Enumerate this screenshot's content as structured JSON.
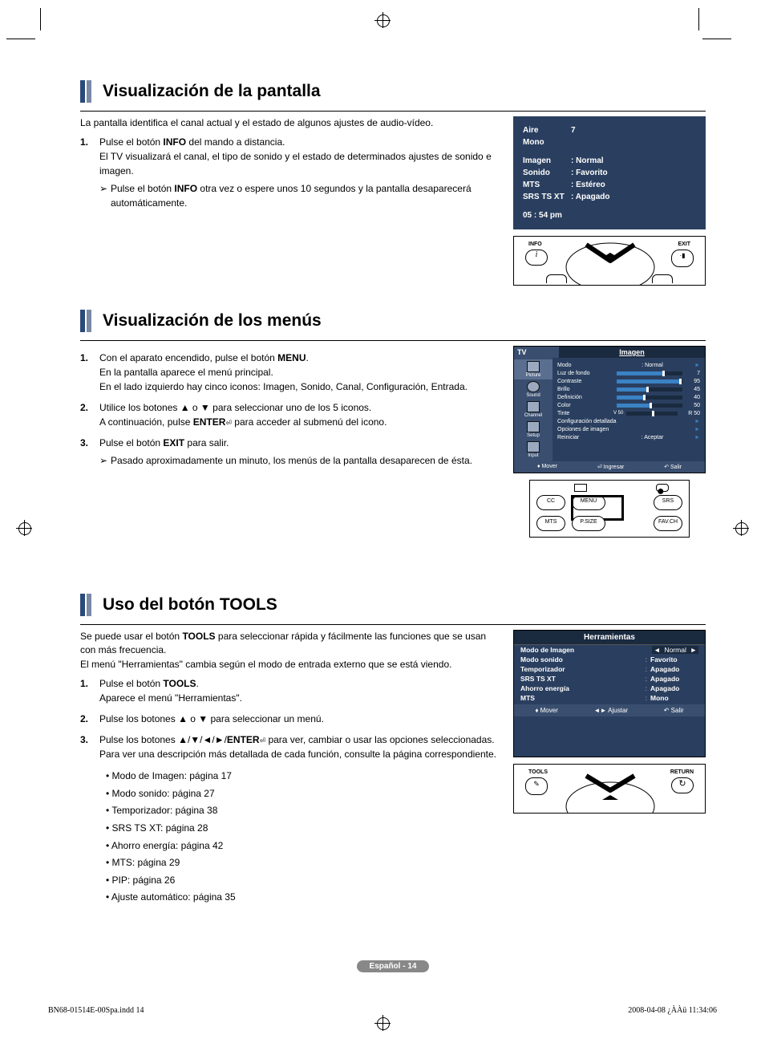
{
  "sections": {
    "s1": {
      "title": "Visualización de la pantalla",
      "intro": "La pantalla identifica el canal actual y el estado de algunos ajustes de audio-vídeo.",
      "step1a": "Pulse el botón ",
      "step1b": "INFO",
      "step1c": " del mando a distancia.",
      "step1d": "El TV visualizará el canal, el tipo de sonido y el estado de determinados ajustes de sonido e imagen.",
      "note1a": "Pulse el botón ",
      "note1b": "INFO",
      "note1c": " otra vez o espere unos 10 segundos y la pantalla desaparecerá automáticamente."
    },
    "s2": {
      "title": "Visualización de los menús",
      "step1a": "Con el aparato encendido, pulse el botón ",
      "step1b": "MENU",
      "step1c": ".",
      "step1d": "En la pantalla aparece el menú principal.",
      "step1e": "En el lado izquierdo hay cinco iconos: Imagen, Sonido, Canal, Configuración, Entrada.",
      "step2a": "Utilice los botones ▲ o ▼ para seleccionar uno de los 5 iconos.",
      "step2b": "A continuación, pulse ",
      "step2c": "ENTER",
      "step2d": " para acceder al submenú del icono.",
      "step3a": "Pulse el botón ",
      "step3b": "EXIT",
      "step3c": " para salir.",
      "note1": "Pasado aproximadamente un minuto, los menús de la pantalla desaparecen de ésta."
    },
    "s3": {
      "title": "Uso del botón TOOLS",
      "intro1": "Se puede usar el botón ",
      "intro1b": "TOOLS",
      "intro1c": " para seleccionar rápida y fácilmente las funciones que se usan con más frecuencia.",
      "intro2": "El menú \"Herramientas\" cambia según el modo de entrada externo que se está viendo.",
      "step1a": "Pulse el botón ",
      "step1b": "TOOLS",
      "step1c": ".",
      "step1d": "Aparece el menú \"Herramientas\".",
      "step2": "Pulse los botones ▲ o ▼ para seleccionar un menú.",
      "step3a": "Pulse los botones ▲/▼/◄/►/",
      "step3b": "ENTER",
      "step3c": "  para ver, cambiar o usar las opciones seleccionadas. Para ver una descripción más detallada de cada función, consulte la página correspondiente.",
      "bullets": {
        "b1": "• Modo de Imagen: página 17",
        "b2": "• Modo sonido: página 27",
        "b3": "• Temporizador: página 38",
        "b4": "• SRS TS XT: página 28",
        "b5": "• Ahorro energía: página 42",
        "b6": "• MTS: página 29",
        "b7": "• PIP: página 26",
        "b8": "• Ajuste automático: página 35"
      }
    }
  },
  "osd1": {
    "air": "Aire",
    "ch": "7",
    "mono": "Mono",
    "rows": [
      {
        "lbl": "Imagen",
        "val": ": Normal"
      },
      {
        "lbl": "Sonido",
        "val": ": Favorito"
      },
      {
        "lbl": "MTS",
        "val": ": Estéreo"
      },
      {
        "lbl": "SRS TS XT",
        "val": ": Apagado"
      }
    ],
    "time": "05 : 54 pm"
  },
  "remote1": {
    "info": "INFO",
    "exit": "EXIT"
  },
  "menu_osd": {
    "tv": "TV",
    "cat": "Imagen",
    "sidebar": [
      "Picture",
      "Sound",
      "Channel",
      "Setup",
      "Input"
    ],
    "rows": [
      {
        "lbl": "Modo",
        "txt": ": Normal",
        "arrow": true
      },
      {
        "lbl": "Luz de fondo",
        "slider": 70,
        "val": "7"
      },
      {
        "lbl": "Contraste",
        "slider": 95,
        "val": "95"
      },
      {
        "lbl": "Brillo",
        "slider": 45,
        "val": "45"
      },
      {
        "lbl": "Definición",
        "slider": 40,
        "val": "40"
      },
      {
        "lbl": "Color",
        "slider": 50,
        "val": "50"
      },
      {
        "lbl": "Tinte",
        "txt2": "V 50",
        "slider": 50,
        "val": "R 50"
      },
      {
        "lbl": "Configuración detallada",
        "arrow": true
      },
      {
        "lbl": "Opciones de imagen",
        "arrow": true
      },
      {
        "lbl": "Reiniciar",
        "txt": ": Aceptar",
        "arrow": true
      }
    ],
    "footer": {
      "move": "Mover",
      "enter": "Ingresar",
      "exit": "Salir"
    }
  },
  "remote2": {
    "cc": "CC",
    "menu": "MENU",
    "srs": "SRS",
    "mts": "MTS",
    "psize": "P.SIZE",
    "favch": "FAV.CH"
  },
  "tools_osd": {
    "title": "Herramientas",
    "rows": [
      {
        "lbl": "Modo de Imagen",
        "val": "Normal",
        "active": true
      },
      {
        "lbl": "Modo sonido",
        "val": "Favorito"
      },
      {
        "lbl": "Temporizador",
        "val": "Apagado"
      },
      {
        "lbl": "SRS TS XT",
        "val": "Apagado"
      },
      {
        "lbl": "Ahorro energía",
        "val": "Apagado"
      },
      {
        "lbl": "MTS",
        "val": "Mono"
      }
    ],
    "footer": {
      "move": "Mover",
      "adjust": "Ajustar",
      "exit": "Salir"
    }
  },
  "remote3": {
    "tools": "TOOLS",
    "return": "RETURN"
  },
  "page_badge": "Español - 14",
  "footer": {
    "left": "BN68-01514E-00Spa.indd   14",
    "right": "2008-04-08   ¿ÀÀü 11:34:06"
  }
}
